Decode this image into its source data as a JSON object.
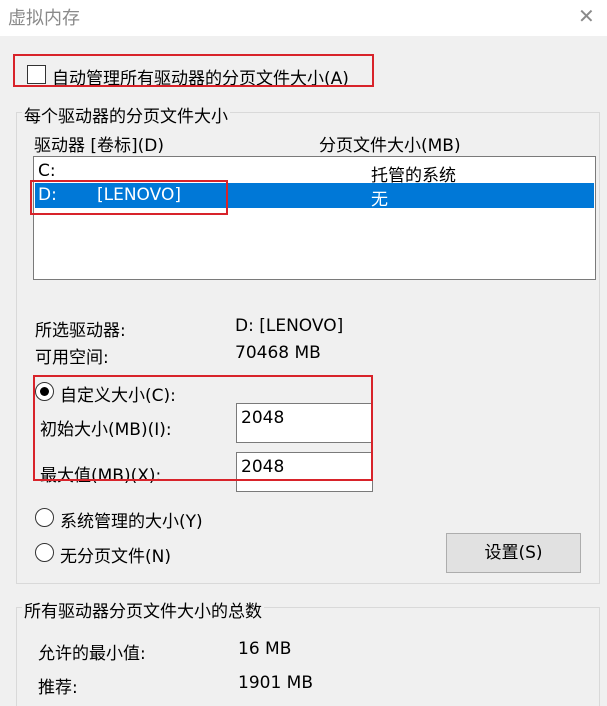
{
  "window": {
    "title": "虚拟内存",
    "close_glyph": "✕"
  },
  "auto_manage": {
    "label": "自动管理所有驱动器的分页文件大小(A)",
    "checked": false
  },
  "per_drive": {
    "legend": "每个驱动器的分页文件大小",
    "columns": [
      "驱动器 [卷标](D)",
      "分页文件大小(MB)"
    ],
    "rows": [
      {
        "drive": "C:",
        "label": "",
        "size": "托管的系统",
        "selected": false
      },
      {
        "drive": "D:",
        "label": "[LENOVO]",
        "size": "无",
        "selected": true
      }
    ],
    "selected_drive_label": "所选驱动器:",
    "selected_drive_value": "D:  [LENOVO]",
    "free_space_label": "可用空间:",
    "free_space_value": "70468 MB",
    "custom_size_label": "自定义大小(C):",
    "initial_size_label": "初始大小(MB)(I):",
    "initial_size_value": "2048",
    "max_size_label": "最大值(MB)(X):",
    "max_size_value": "2048",
    "system_managed_label": "系统管理的大小(Y)",
    "no_paging_label": "无分页文件(N)",
    "selected_option": "custom",
    "set_button": "设置(S)"
  },
  "totals": {
    "legend": "所有驱动器分页文件大小的总数",
    "min_allowed_label": "允许的最小值:",
    "min_allowed_value": "16 MB",
    "recommended_label": "推荐:",
    "recommended_value": "1901 MB"
  },
  "colors": {
    "highlight": "#d8232a",
    "selection": "#0078d7"
  }
}
